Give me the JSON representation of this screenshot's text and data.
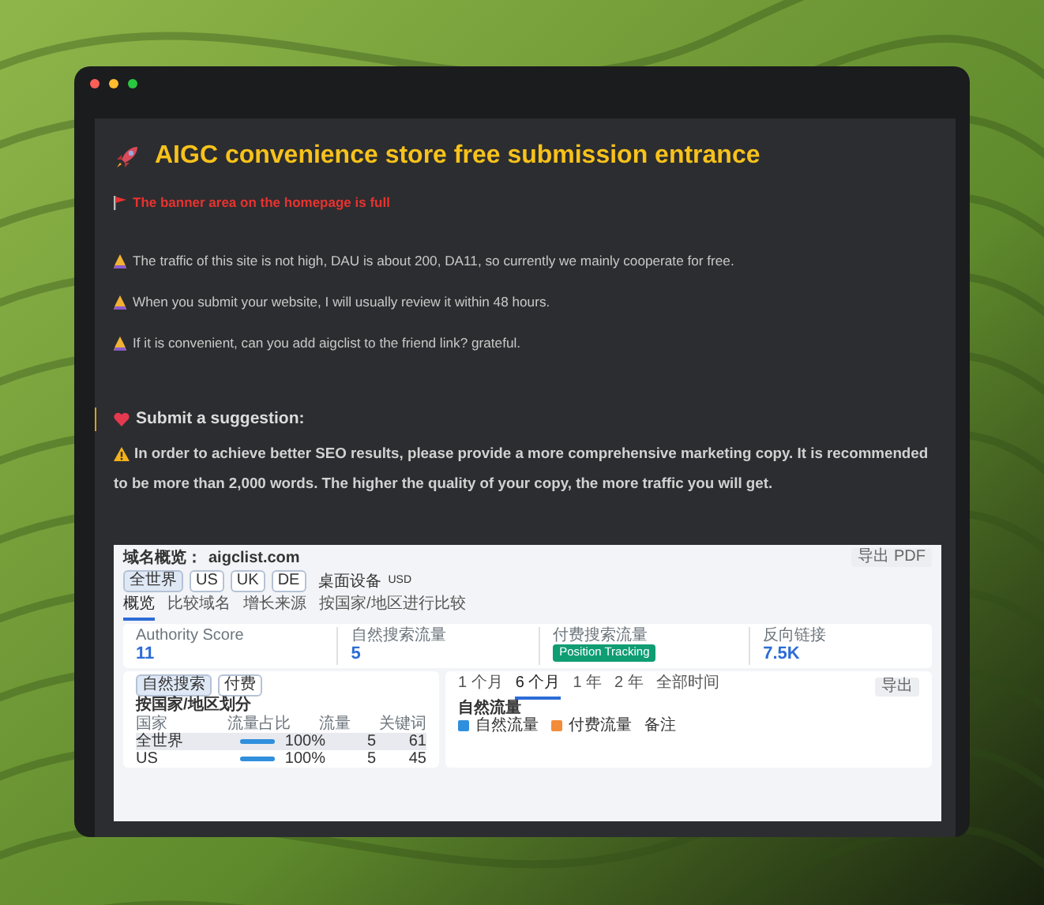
{
  "window": {
    "controls": [
      {
        "color": "#ff5f57"
      },
      {
        "color": "#febc2e"
      },
      {
        "color": "#28c840"
      }
    ]
  },
  "article": {
    "title": "AIGC convenience store free submission entrance",
    "notice": "The banner area on the homepage is full",
    "notes": [
      "The traffic of this site is not high, DAU is about 200, DA11, so currently we mainly cooperate for free.",
      "When you submit your website, I will usually review it within 48 hours.",
      "If it is convenient, can you add aigclist to the friend link? grateful."
    ],
    "suggestion": {
      "heading": "Submit a suggestion:",
      "text": "In order to achieve better SEO results, please provide a more comprehensive marketing copy. It is recommended to be more than 2,000 words. The higher the quality of your copy, the more traffic you will get."
    }
  },
  "screenshot": {
    "heading": "域名概览：",
    "domain": "aigclist.com",
    "export_pdf": "导出 PDF",
    "regions": [
      {
        "label": "全世界",
        "selected": true
      },
      {
        "label": "US",
        "selected": false
      },
      {
        "label": "UK",
        "selected": false
      },
      {
        "label": "DE",
        "selected": false
      }
    ],
    "device": "桌面设备",
    "currency": "USD",
    "tabs": [
      {
        "label": "概览",
        "selected": true
      },
      {
        "label": "比较域名",
        "selected": false
      },
      {
        "label": "增长来源",
        "selected": false
      },
      {
        "label": "按国家/地区进行比较",
        "selected": false
      }
    ],
    "metrics": [
      {
        "label": "Authority Score",
        "value": "11"
      },
      {
        "label": "自然搜索流量",
        "value": "5"
      },
      {
        "label": "付费搜索流量",
        "button": "Position Tracking"
      },
      {
        "label": "反向链接",
        "value": "7.5K"
      }
    ],
    "traffic_tabs": [
      {
        "label": "自然搜索",
        "selected": true
      },
      {
        "label": "付费",
        "selected": false
      }
    ],
    "country_title": "按国家/地区划分",
    "columns": [
      "国家",
      "流量占比",
      "流量",
      "关键词"
    ],
    "rows": [
      {
        "country": "全世界",
        "level": 1,
        "share": "100%",
        "traffic": "5",
        "keywords": "61",
        "selected": true
      },
      {
        "country": "US",
        "level": 1,
        "share": "100%",
        "traffic": "5",
        "keywords": "45",
        "selected": false
      }
    ],
    "periods": [
      {
        "label": "1 个月",
        "selected": false
      },
      {
        "label": "6 个月",
        "selected": true
      },
      {
        "label": "1 年",
        "selected": false
      },
      {
        "label": "2 年",
        "selected": false
      },
      {
        "label": "全部时间",
        "selected": false
      }
    ],
    "export": "导出",
    "chart_title": "自然流量",
    "legend": [
      {
        "label": "自然流量",
        "checked": true,
        "color": "#2f8fdd"
      },
      {
        "label": "付费流量",
        "checked": true,
        "color": "#f28c38"
      }
    ],
    "notes_button": "备注"
  }
}
